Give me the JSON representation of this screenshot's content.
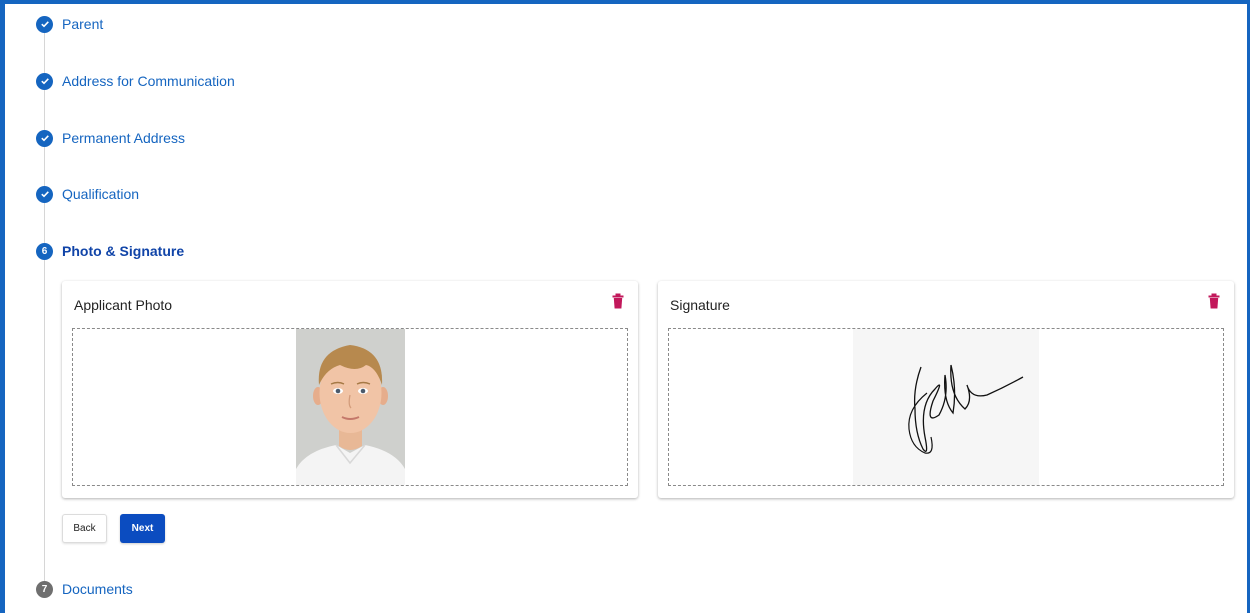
{
  "stepper": {
    "steps": [
      {
        "label": "Parent",
        "status": "done"
      },
      {
        "label": "Address for Communication",
        "status": "done"
      },
      {
        "label": "Permanent Address",
        "status": "done"
      },
      {
        "label": "Qualification",
        "status": "done"
      },
      {
        "label": "Photo & Signature",
        "status": "active",
        "number": "6"
      },
      {
        "label": "Documents",
        "status": "pending",
        "number": "7"
      }
    ]
  },
  "photo_card": {
    "title": "Applicant Photo",
    "delete_icon": "trash-icon"
  },
  "signature_card": {
    "title": "Signature",
    "delete_icon": "trash-icon"
  },
  "actions": {
    "back_label": "Back",
    "next_label": "Next"
  },
  "colors": {
    "primary": "#1565c0",
    "button_primary": "#0b4cc0",
    "delete": "#c2185b",
    "pending": "#6f6f6f"
  }
}
